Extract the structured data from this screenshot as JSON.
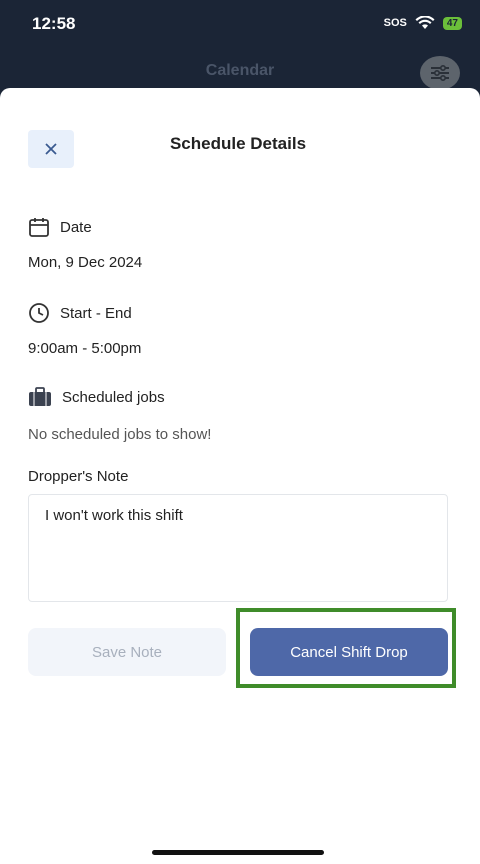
{
  "status_bar": {
    "time": "12:58",
    "sos": "SOS",
    "battery": "47"
  },
  "background": {
    "title": "Calendar",
    "filter_icon": "sliders-icon"
  },
  "sheet": {
    "title": "Schedule Details",
    "close_icon": "close-icon",
    "date": {
      "icon": "calendar-icon",
      "label": "Date",
      "value": "Mon, 9 Dec 2024"
    },
    "time_range": {
      "icon": "clock-icon",
      "label": "Start - End",
      "value": "9:00am - 5:00pm"
    },
    "jobs": {
      "icon": "briefcase-icon",
      "label": "Scheduled jobs",
      "empty_text": "No scheduled jobs to show!"
    },
    "note": {
      "label": "Dropper's Note",
      "value": "I won't work this shift"
    },
    "save_label": "Save Note",
    "cancel_label": "Cancel Shift Drop"
  },
  "colors": {
    "header_bg": "#1b2536",
    "accent": "#4e68a8",
    "highlight": "#3f8c2a"
  }
}
